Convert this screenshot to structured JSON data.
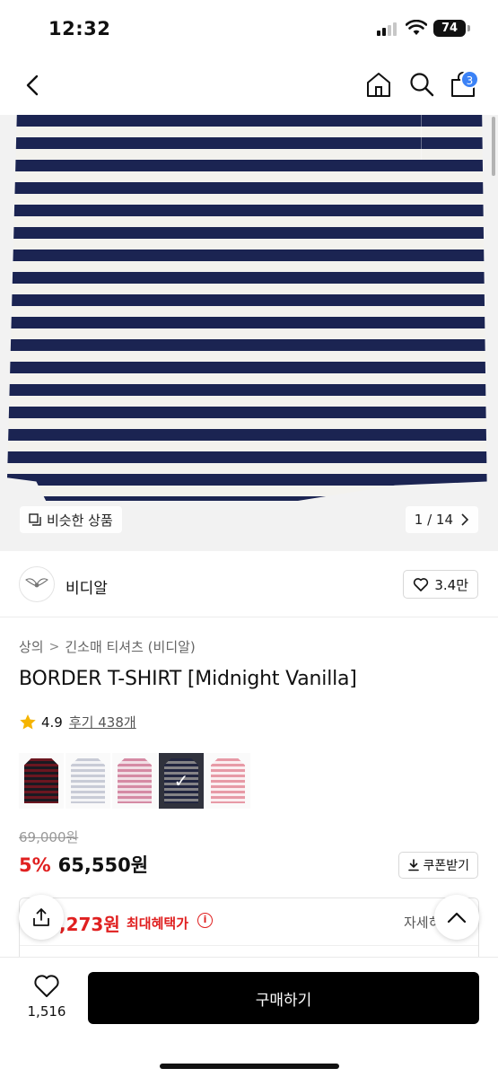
{
  "status_bar": {
    "time": "12:32",
    "battery": "74"
  },
  "nav": {
    "cart_count": "3"
  },
  "gallery": {
    "similar_label": "비슷한 상품",
    "page_indicator": "1 / 14",
    "stripe_colors": [
      "#1b2452",
      "#f3f2ee"
    ]
  },
  "brand": {
    "name": "비디알",
    "likes": "3.4만"
  },
  "breadcrumb": [
    "상의",
    "긴소매 티셔츠 (비디알)"
  ],
  "product": {
    "title": "BORDER T-SHIRT [Midnight Vanilla]",
    "rating": "4.9",
    "reviews": "후기 438개",
    "original_price": "69,000원",
    "discount": "5%",
    "price": "65,550원",
    "coupon_label": "쿠폰받기",
    "max_benefit_price": ",273원",
    "max_benefit_label": "최대혜택가",
    "detail_label": "자세히"
  },
  "swatches": [
    {
      "name": "burgundy",
      "stripe_a": "#6b1620",
      "stripe_b": "#1a1a22",
      "selected": false
    },
    {
      "name": "grey",
      "stripe_a": "#c8cbd6",
      "stripe_b": "#f4f4f6",
      "selected": false
    },
    {
      "name": "pink",
      "stripe_a": "#d58aa4",
      "stripe_b": "#f1dde4",
      "selected": false
    },
    {
      "name": "navy",
      "stripe_a": "#1b2452",
      "stripe_b": "#f3f2ee",
      "selected": true
    },
    {
      "name": "light-pink",
      "stripe_a": "#e79aa6",
      "stripe_b": "#fbeef0",
      "selected": false
    }
  ],
  "bottom_bar": {
    "wish_count": "1,516",
    "buy_label": "구매하기"
  },
  "colors": {
    "accent_red": "#e02020",
    "badge_blue": "#3b82f6",
    "buy_bg": "#000000"
  }
}
